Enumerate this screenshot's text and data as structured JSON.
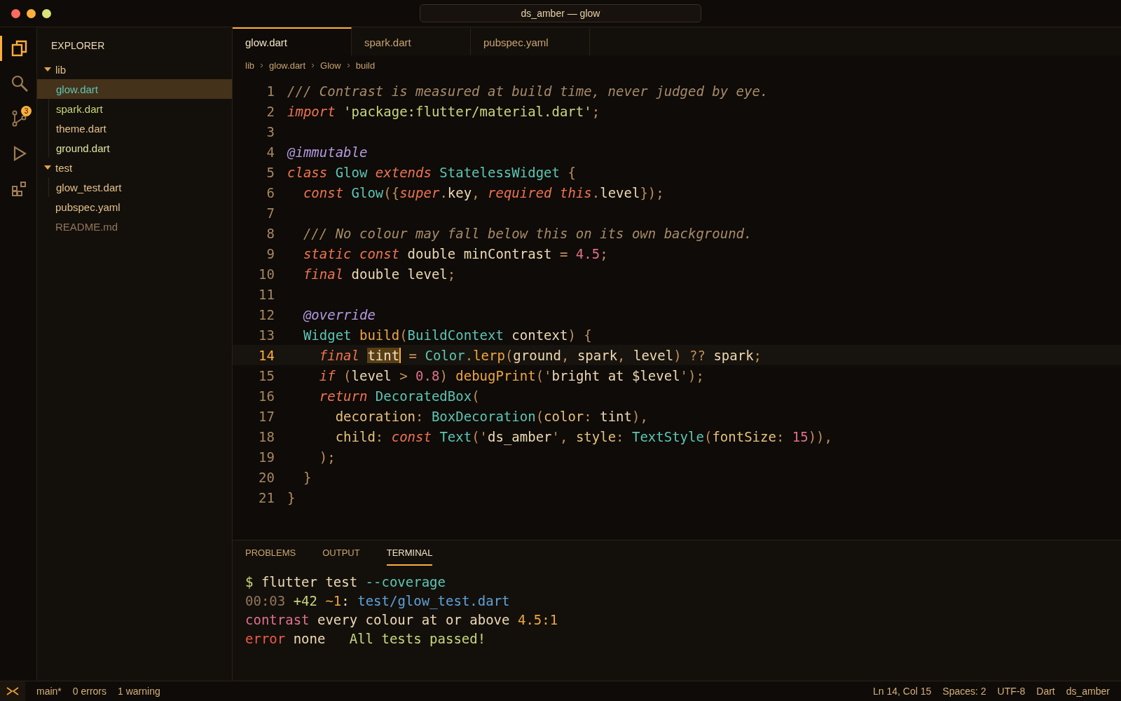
{
  "window": {
    "title": "ds_amber — glow"
  },
  "activity_bar": {
    "items": [
      {
        "kind": "files",
        "selected": true
      },
      {
        "kind": "search",
        "selected": false
      },
      {
        "kind": "git",
        "selected": false,
        "badge": "3"
      },
      {
        "kind": "run",
        "selected": false
      },
      {
        "kind": "extensions",
        "selected": false
      }
    ]
  },
  "sidebar": {
    "title": "EXPLORER",
    "items": [
      {
        "label": "lib",
        "kind": "folder",
        "expanded": true,
        "children": [
          {
            "label": "glow.dart",
            "selected": true,
            "color": "#5cc6b4"
          },
          {
            "label": "spark.dart",
            "selected": false,
            "color": "#c9d67a"
          },
          {
            "label": "theme.dart",
            "selected": false,
            "color": "#e3c08a"
          },
          {
            "label": "ground.dart",
            "selected": false,
            "color": "#dfe3a0"
          }
        ]
      },
      {
        "label": "test",
        "kind": "folder",
        "expanded": true,
        "children": [
          {
            "label": "glow_test.dart",
            "selected": false,
            "color": "#e3c08a"
          }
        ]
      },
      {
        "label": "pubspec.yaml",
        "kind": "file",
        "selected": false,
        "color": "#e3c08a"
      },
      {
        "label": "README.md",
        "kind": "file",
        "selected": false,
        "color": "#94765a"
      }
    ]
  },
  "tabs": [
    {
      "label": "glow.dart",
      "selected": true
    },
    {
      "label": "spark.dart",
      "selected": false
    },
    {
      "label": "pubspec.yaml",
      "selected": false
    }
  ],
  "breadcrumbs": [
    "lib",
    "glow.dart",
    "Glow",
    "build"
  ],
  "code": [
    {
      "n": "1",
      "active": false,
      "tokens": [
        {
          "text": "/// Contrast is measured at build time, never judged by eye.",
          "kind": "comment"
        }
      ]
    },
    {
      "n": "2",
      "active": false,
      "tokens": [
        {
          "text": "import ",
          "kind": "kw"
        },
        {
          "text": "'package:flutter/material.dart'",
          "kind": "str"
        },
        {
          "text": ";",
          "kind": "punct"
        }
      ]
    },
    {
      "n": "3",
      "active": false
    },
    {
      "n": "4",
      "active": false,
      "tokens": [
        {
          "text": "@immutable",
          "kind": "annot"
        }
      ]
    },
    {
      "n": "5",
      "active": false,
      "tokens": [
        {
          "text": "class ",
          "kind": "kw"
        },
        {
          "text": "Glow ",
          "kind": "type"
        },
        {
          "text": "extends ",
          "kind": "kw"
        },
        {
          "text": "StatelessWidget ",
          "kind": "type"
        },
        {
          "text": "{",
          "kind": "punct"
        }
      ]
    },
    {
      "n": "6",
      "active": false,
      "tokens": [
        {
          "text": "  const ",
          "kind": "kw"
        },
        {
          "text": "Glow",
          "kind": "type"
        },
        {
          "text": "({",
          "kind": "punct"
        },
        {
          "text": "super",
          "kind": "kw"
        },
        {
          "text": ".",
          "kind": "punct"
        },
        {
          "text": "key",
          "kind": "plain"
        },
        {
          "text": ", ",
          "kind": "punct"
        },
        {
          "text": "required this",
          "kind": "kw"
        },
        {
          "text": ".",
          "kind": "punct"
        },
        {
          "text": "level",
          "kind": "plain"
        },
        {
          "text": "});",
          "kind": "punct"
        }
      ]
    },
    {
      "n": "7",
      "active": false
    },
    {
      "n": "8",
      "active": false,
      "tokens": [
        {
          "text": "  /// No colour may fall below this on its own background.",
          "kind": "comment"
        }
      ]
    },
    {
      "n": "9",
      "active": false,
      "tokens": [
        {
          "text": "  static const ",
          "kind": "kw"
        },
        {
          "text": "double minContrast ",
          "kind": "plain"
        },
        {
          "text": "= ",
          "kind": "punct"
        },
        {
          "text": "4.5",
          "kind": "num"
        },
        {
          "text": ";",
          "kind": "punct"
        }
      ]
    },
    {
      "n": "10",
      "active": false,
      "tokens": [
        {
          "text": "  final ",
          "kind": "kw"
        },
        {
          "text": "double level",
          "kind": "plain"
        },
        {
          "text": ";",
          "kind": "punct"
        }
      ]
    },
    {
      "n": "11",
      "active": false
    },
    {
      "n": "12",
      "active": false,
      "tokens": [
        {
          "text": "  @override",
          "kind": "annot"
        }
      ]
    },
    {
      "n": "13",
      "active": false,
      "tokens": [
        {
          "text": "  Widget ",
          "kind": "type"
        },
        {
          "text": "build",
          "kind": "fn"
        },
        {
          "text": "(",
          "kind": "punct"
        },
        {
          "text": "BuildContext ",
          "kind": "type"
        },
        {
          "text": "context",
          "kind": "plain"
        },
        {
          "text": ") {",
          "kind": "punct"
        }
      ]
    },
    {
      "n": "14",
      "active": true,
      "tokens": [
        {
          "text": "    final ",
          "kind": "kw"
        },
        {
          "text": "tint",
          "kind": "sel"
        },
        {
          "text": " = ",
          "kind": "punct"
        },
        {
          "text": "Color",
          "kind": "type"
        },
        {
          "text": ".",
          "kind": "punct"
        },
        {
          "text": "lerp",
          "kind": "fn"
        },
        {
          "text": "(",
          "kind": "punct"
        },
        {
          "text": "ground",
          "kind": "plain"
        },
        {
          "text": ", ",
          "kind": "punct"
        },
        {
          "text": "spark",
          "kind": "plain"
        },
        {
          "text": ", ",
          "kind": "punct"
        },
        {
          "text": "level",
          "kind": "plain"
        },
        {
          "text": ") ?? ",
          "kind": "punct"
        },
        {
          "text": "spark",
          "kind": "plain"
        },
        {
          "text": ";",
          "kind": "punct"
        }
      ]
    },
    {
      "n": "15",
      "active": false,
      "tokens": [
        {
          "text": "    if ",
          "kind": "kw"
        },
        {
          "text": "(",
          "kind": "punct"
        },
        {
          "text": "level ",
          "kind": "plain"
        },
        {
          "text": "> ",
          "kind": "punct"
        },
        {
          "text": "0.8",
          "kind": "num"
        },
        {
          "text": ") ",
          "kind": "punct"
        },
        {
          "text": "debugPrint",
          "kind": "fn"
        },
        {
          "text": "('",
          "kind": "punct"
        },
        {
          "text": "bright at $level",
          "kind": "plain"
        },
        {
          "text": "');",
          "kind": "punct"
        }
      ]
    },
    {
      "n": "16",
      "active": false,
      "tokens": [
        {
          "text": "    return ",
          "kind": "kw"
        },
        {
          "text": "DecoratedBox",
          "kind": "type"
        },
        {
          "text": "(",
          "kind": "punct"
        }
      ]
    },
    {
      "n": "17",
      "active": false,
      "tokens": [
        {
          "text": "      decoration",
          "kind": "prop"
        },
        {
          "text": ": ",
          "kind": "punct"
        },
        {
          "text": "BoxDecoration",
          "kind": "type"
        },
        {
          "text": "(",
          "kind": "punct"
        },
        {
          "text": "color",
          "kind": "prop"
        },
        {
          "text": ": ",
          "kind": "punct"
        },
        {
          "text": "tint",
          "kind": "plain"
        },
        {
          "text": "),",
          "kind": "punct"
        }
      ]
    },
    {
      "n": "18",
      "active": false,
      "tokens": [
        {
          "text": "      child",
          "kind": "prop"
        },
        {
          "text": ": ",
          "kind": "punct"
        },
        {
          "text": "const ",
          "kind": "kw"
        },
        {
          "text": "Text",
          "kind": "type"
        },
        {
          "text": "('",
          "kind": "punct"
        },
        {
          "text": "ds_amber",
          "kind": "plain"
        },
        {
          "text": "', ",
          "kind": "punct"
        },
        {
          "text": "style",
          "kind": "prop"
        },
        {
          "text": ": ",
          "kind": "punct"
        },
        {
          "text": "TextStyle",
          "kind": "type"
        },
        {
          "text": "(",
          "kind": "punct"
        },
        {
          "text": "fontSize",
          "kind": "prop"
        },
        {
          "text": ": ",
          "kind": "punct"
        },
        {
          "text": "15",
          "kind": "num"
        },
        {
          "text": ")),",
          "kind": "punct"
        }
      ]
    },
    {
      "n": "19",
      "active": false,
      "tokens": [
        {
          "text": "    );",
          "kind": "punct"
        }
      ]
    },
    {
      "n": "20",
      "active": false,
      "tokens": [
        {
          "text": "  }",
          "kind": "punct"
        }
      ]
    },
    {
      "n": "21",
      "active": false,
      "tokens": [
        {
          "text": "}",
          "kind": "punct"
        }
      ]
    }
  ],
  "panel": {
    "tabs": [
      {
        "label": "PROBLEMS",
        "selected": false
      },
      {
        "label": "OUTPUT",
        "selected": false
      },
      {
        "label": "TERMINAL",
        "selected": true
      }
    ],
    "terminal": [
      {
        "tokens": [
          {
            "text": "$ ",
            "kind": "prompt"
          },
          {
            "text": "flutter test ",
            "kind": "plain"
          },
          {
            "text": "--coverage",
            "kind": "flag"
          }
        ]
      },
      {
        "tokens": [
          {
            "text": "00:03 ",
            "kind": "dim"
          },
          {
            "text": "+42 ",
            "kind": "pass"
          },
          {
            "text": "~1",
            "kind": "skip"
          },
          {
            "text": ": ",
            "kind": "plain"
          },
          {
            "text": "test/glow_test.dart",
            "kind": "path"
          }
        ]
      },
      {
        "tokens": [
          {
            "text": "contrast ",
            "kind": "tag"
          },
          {
            "text": "every colour at or above ",
            "kind": "plain"
          },
          {
            "text": "4.5:1",
            "kind": "skip"
          }
        ]
      },
      {
        "tokens": [
          {
            "text": "error ",
            "kind": "err"
          },
          {
            "text": "none   ",
            "kind": "plain"
          },
          {
            "text": "All tests passed!",
            "kind": "pass"
          }
        ]
      }
    ]
  },
  "status_bar": {
    "left": [
      "main*",
      "0 errors",
      "1 warning"
    ],
    "right": [
      "Ln 14, Col 15",
      "Spaces: 2",
      "UTF-8",
      "Dart",
      "ds_amber"
    ]
  }
}
